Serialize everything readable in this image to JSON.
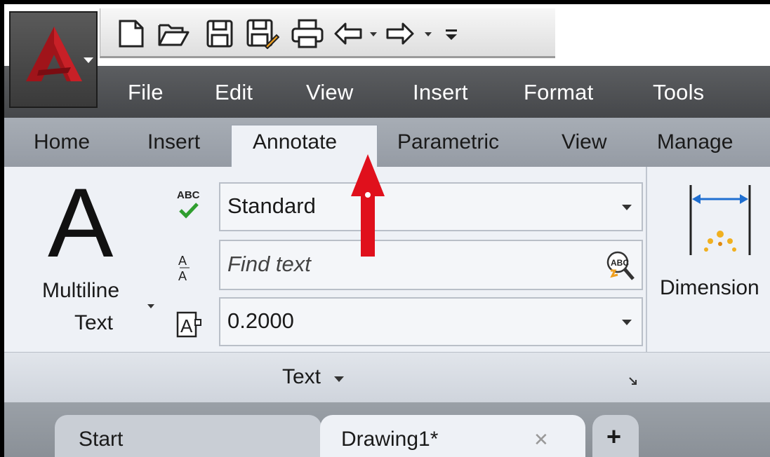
{
  "quick_access": {
    "icons": [
      "new-icon",
      "open-icon",
      "save-icon",
      "save-as-icon",
      "plot-icon",
      "undo-icon",
      "redo-icon",
      "customize-icon"
    ]
  },
  "menu": {
    "items": [
      "File",
      "Edit",
      "View",
      "Insert",
      "Format",
      "Tools"
    ]
  },
  "ribbon_tabs": {
    "items": [
      "Home",
      "Insert",
      "Annotate",
      "Parametric",
      "View",
      "Manage"
    ],
    "active": "Annotate"
  },
  "text_panel": {
    "big_button_line1": "Multiline",
    "big_button_line2": "Text",
    "style_value": "Standard",
    "spell_icon_label": "ABC",
    "find_placeholder": "Find text",
    "height_value": "0.2000",
    "footer_label": "Text"
  },
  "dimension_panel": {
    "label": "Dimension"
  },
  "doc_tabs": {
    "items": [
      "Start",
      "Drawing1*"
    ],
    "active": "Drawing1*"
  },
  "colors": {
    "accent_red": "#e0101c",
    "app_logo_red": "#a0141a",
    "dim_blue": "#1f6fd1"
  }
}
